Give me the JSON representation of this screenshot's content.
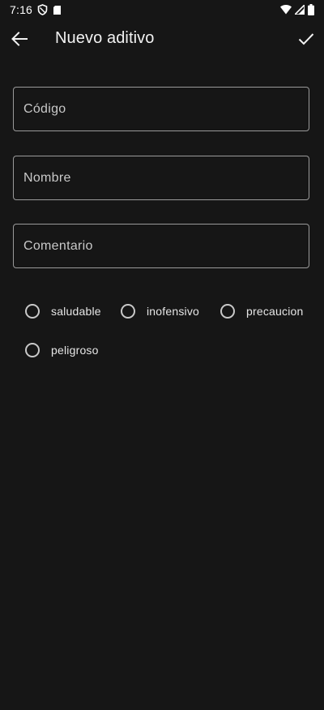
{
  "status_bar": {
    "time": "7:16",
    "icons": [
      "shield-icon",
      "sd-card-icon",
      "wifi-icon",
      "signal-icon",
      "battery-icon"
    ]
  },
  "app_bar": {
    "title": "Nuevo aditivo",
    "back_icon": "arrow-left-icon",
    "confirm_icon": "check-icon"
  },
  "form": {
    "codigo_placeholder": "Código",
    "nombre_placeholder": "Nombre",
    "comentario_placeholder": "Comentario",
    "codigo_value": "",
    "nombre_value": "",
    "comentario_value": ""
  },
  "classification": {
    "options": [
      {
        "label": "saludable",
        "selected": false
      },
      {
        "label": "inofensivo",
        "selected": false
      },
      {
        "label": "precaucion",
        "selected": false
      },
      {
        "label": "peligroso",
        "selected": false
      }
    ]
  },
  "colors": {
    "background": "#161616",
    "text": "#e8e8e8",
    "outline": "#9a9a9a"
  }
}
